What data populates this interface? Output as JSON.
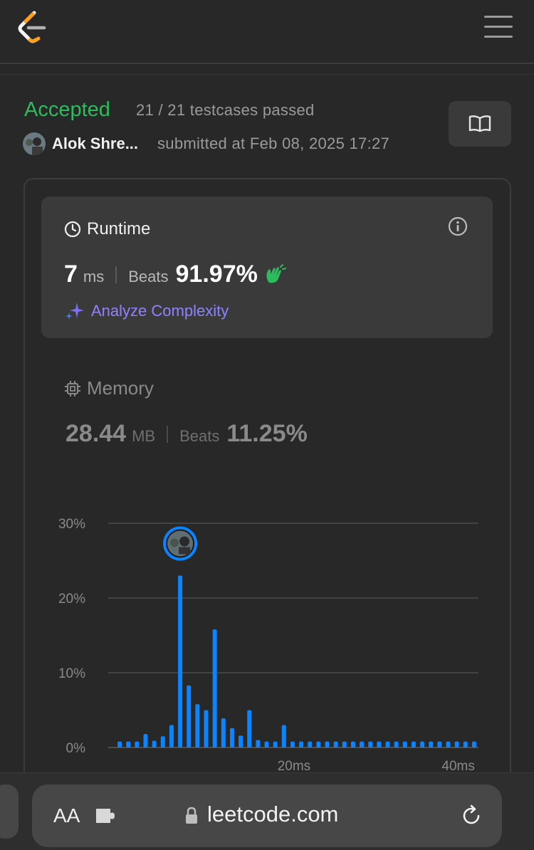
{
  "header": {
    "logo_icon": "leetcode-logo-icon",
    "menu_icon": "hamburger-menu-icon"
  },
  "submission": {
    "status": "Accepted",
    "status_color": "#2cbb5d",
    "testcases": "21 / 21 testcases passed",
    "username": "Alok Shre...",
    "submitted_at": "submitted at Feb 08, 2025 17:27"
  },
  "runtime": {
    "title": "Runtime",
    "value": "7",
    "unit": "ms",
    "beats_label": "Beats",
    "beats_value": "91.97%",
    "analyze_label": "Analyze Complexity"
  },
  "memory": {
    "title": "Memory",
    "value": "28.44",
    "unit": "MB",
    "beats_label": "Beats",
    "beats_value": "11.25%"
  },
  "chart_data": {
    "type": "bar",
    "y_tick_labels": [
      "0%",
      "10%",
      "20%",
      "30%"
    ],
    "x_tick_labels": [
      {
        "label": "20ms",
        "index": 20
      },
      {
        "label": "40ms",
        "index": 39
      }
    ],
    "ylim": [
      0,
      30
    ],
    "highlight_index": 7,
    "bar_color": "#0a84ff",
    "values": [
      0.8,
      0.8,
      0.8,
      1.8,
      0.9,
      1.5,
      3.0,
      23.0,
      8.3,
      5.8,
      5.0,
      15.8,
      3.9,
      2.6,
      1.6,
      5.0,
      1.0,
      0.8,
      0.8,
      3.0,
      0.8,
      0.8,
      0.8,
      0.8,
      0.8,
      0.8,
      0.8,
      0.8,
      0.8,
      0.8,
      0.8,
      0.8,
      0.8,
      0.8,
      0.8,
      0.8,
      0.8,
      0.8,
      0.8,
      0.8,
      0.8,
      0.8
    ]
  },
  "browser": {
    "text_size_label": "AA",
    "url": "leetcode.com"
  }
}
